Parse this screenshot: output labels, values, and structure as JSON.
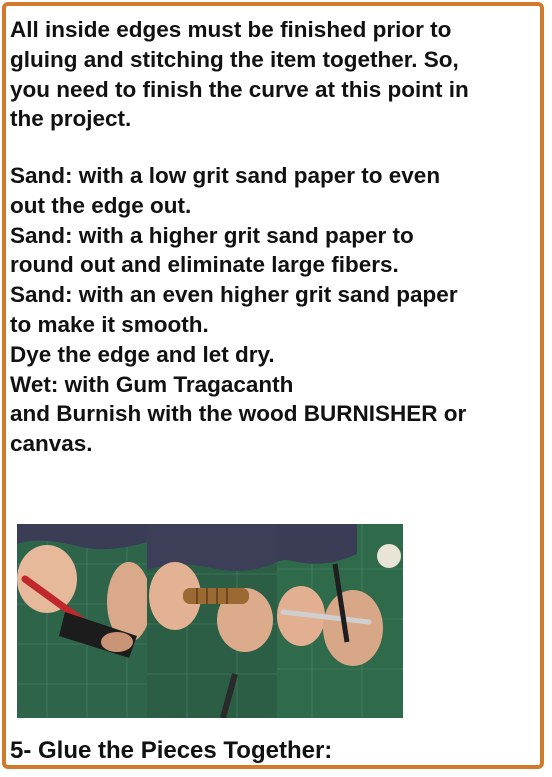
{
  "intro_lines": [
    "All inside edges must be finished prior to",
    "gluing and stitching the item together. So,",
    "you need to finish the curve at this point in",
    "the project."
  ],
  "steps_lines": [
    "Sand: with a low grit sand paper to even",
    "out the edge out.",
    "Sand: with a higher grit sand paper to",
    "round out and eliminate large fibers.",
    "Sand: with an even higher grit sand paper",
    "to make it smooth.",
    "Dye the edge and let dry.",
    "Wet: with Gum Tragacanth",
    "and Burnish with the wood BURNISHER or",
    "canvas."
  ],
  "section_heading": "5- Glue the Pieces Together:",
  "photos": [
    {
      "depicts": "sanding-edge-photo"
    },
    {
      "depicts": "burnishing-edge-photo"
    },
    {
      "depicts": "applying-gum-photo"
    }
  ],
  "colors": {
    "border": "#d27a2c",
    "text": "#111111",
    "mat_green": "#2f6a4a"
  }
}
